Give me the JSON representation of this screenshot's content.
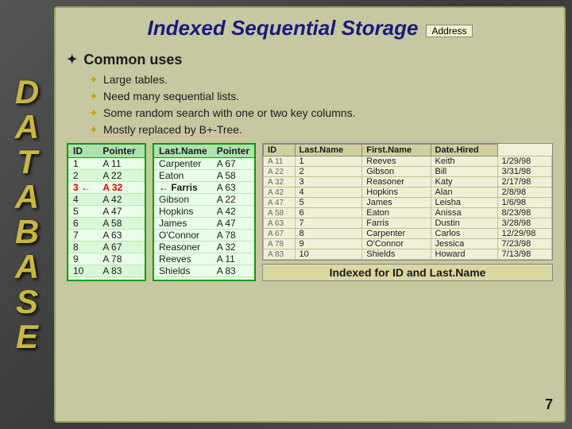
{
  "title": "Indexed Sequential Storage",
  "address_label": "Address",
  "common_uses": {
    "label": "Common uses",
    "star": "✦",
    "bullets": [
      "Large tables.",
      "Need many sequential lists.",
      "Some random search with one or two key columns.",
      "Mostly replaced by B+-Tree."
    ]
  },
  "index_table": {
    "headers": [
      "ID",
      "Pointer"
    ],
    "rows": [
      {
        "id": "1",
        "ptr": "A 11"
      },
      {
        "id": "2",
        "ptr": "A 22"
      },
      {
        "id": "3",
        "ptr": "A 32",
        "arrow": true
      },
      {
        "id": "4",
        "ptr": "A 42"
      },
      {
        "id": "5",
        "ptr": "A 47"
      },
      {
        "id": "6",
        "ptr": "A 58"
      },
      {
        "id": "7",
        "ptr": "A 63"
      },
      {
        "id": "8",
        "ptr": "A 67"
      },
      {
        "id": "9",
        "ptr": "A 78"
      },
      {
        "id": "10",
        "ptr": "A 83"
      }
    ]
  },
  "seq_table": {
    "headers": [
      "Last.Name",
      "Pointer"
    ],
    "rows": [
      {
        "name": "Carpenter",
        "ptr": "A 67"
      },
      {
        "name": "Eaton",
        "ptr": "A 58"
      },
      {
        "name": "Farris",
        "ptr": "A 63",
        "arrow": true
      },
      {
        "name": "Gibson",
        "ptr": "A 22"
      },
      {
        "name": "Hopkins",
        "ptr": "A 42"
      },
      {
        "name": "James",
        "ptr": "A 47"
      },
      {
        "name": "O'Connor",
        "ptr": "A 78"
      },
      {
        "name": "Reasoner",
        "ptr": "A 32"
      },
      {
        "name": "Reeves",
        "ptr": "A 11"
      },
      {
        "name": "Shields",
        "ptr": "A 83"
      }
    ]
  },
  "data_table": {
    "headers": [
      "ID",
      "Last.Name",
      "First.Name",
      "Date.Hired"
    ],
    "address_labels": [
      "A 11",
      "A 22",
      "A 32",
      "A 42",
      "A 47",
      "A 58",
      "A 63",
      "A 67",
      "A 78",
      "A 83"
    ],
    "rows": [
      {
        "id": "1",
        "last": "Reeves",
        "first": "Keith",
        "date": "1/29/98"
      },
      {
        "id": "2",
        "last": "Gibson",
        "first": "Bill",
        "date": "3/31/98"
      },
      {
        "id": "3",
        "last": "Reasoner",
        "first": "Katy",
        "date": "2/17/98"
      },
      {
        "id": "4",
        "last": "Hopkins",
        "first": "Alan",
        "date": "2/8/98"
      },
      {
        "id": "5",
        "last": "James",
        "first": "Leisha",
        "date": "1/6/98"
      },
      {
        "id": "6",
        "last": "Eaton",
        "first": "Anissa",
        "date": "8/23/98"
      },
      {
        "id": "7",
        "last": "Farris",
        "first": "Dustin",
        "date": "3/28/98"
      },
      {
        "id": "8",
        "last": "Carpenter",
        "first": "Carlos",
        "date": "12/29/98"
      },
      {
        "id": "9",
        "last": "O'Connor",
        "first": "Jessica",
        "date": "7/23/98"
      },
      {
        "id": "10",
        "last": "Shields",
        "first": "Howard",
        "date": "7/13/98"
      }
    ]
  },
  "indexed_label": "Indexed for ID and Last.Name",
  "page_number": "7",
  "db_letters": [
    "D",
    "A",
    "T",
    "A",
    "B",
    "A",
    "S",
    "E"
  ]
}
